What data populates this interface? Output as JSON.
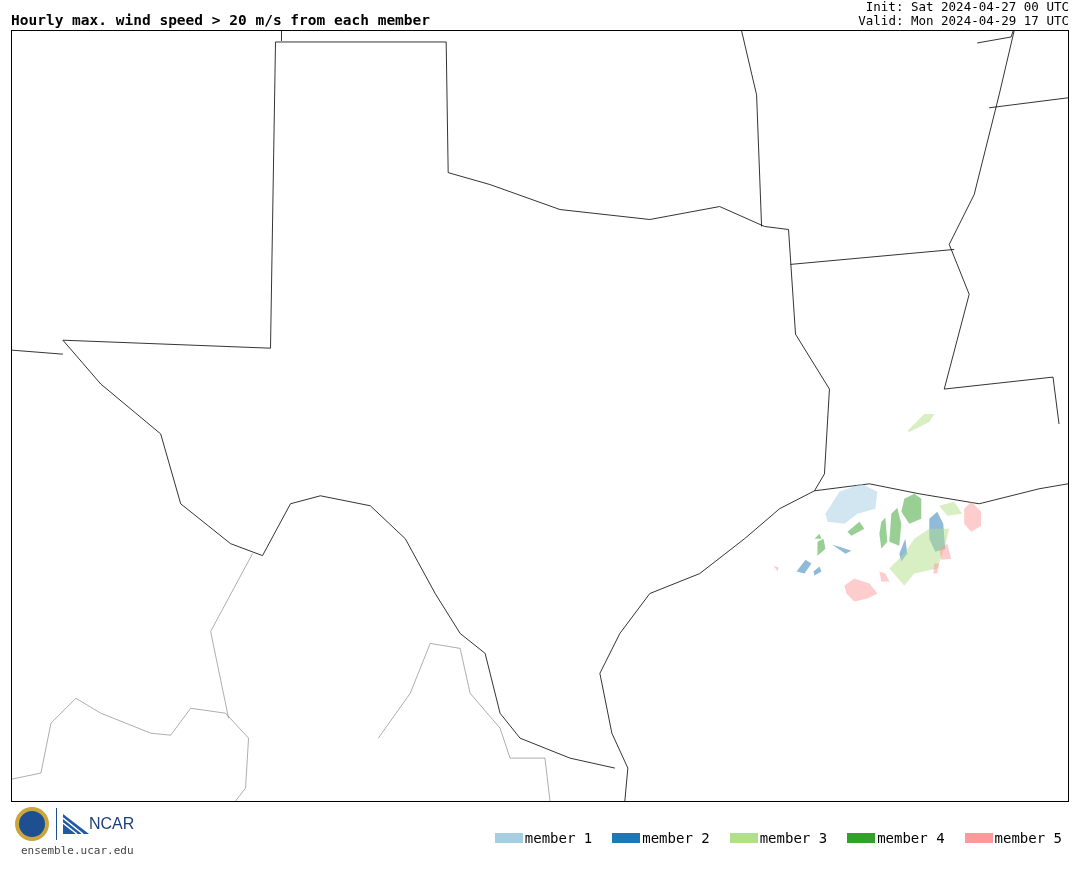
{
  "title": "Hourly max. wind speed > 20 m/s from each member",
  "init": "Init: Sat 2024-04-27 00 UTC",
  "valid": "Valid: Mon 2024-04-29 17 UTC",
  "logo_text": "NCAR",
  "url": "ensemble.ucar.edu",
  "legend": [
    {
      "label": "member 1",
      "color": "#a6cee3"
    },
    {
      "label": "member 2",
      "color": "#1f78b4"
    },
    {
      "label": "member 3",
      "color": "#b2df8a"
    },
    {
      "label": "member 4",
      "color": "#33a02c"
    },
    {
      "label": "member 5",
      "color": "#fb9a99"
    }
  ]
}
